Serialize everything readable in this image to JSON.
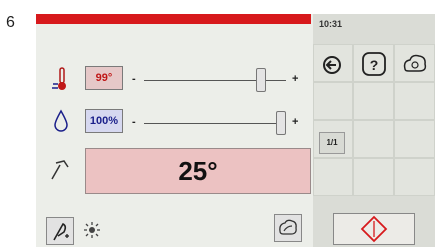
{
  "figure_number": "6",
  "status": {
    "time": "10:31"
  },
  "temperature": {
    "value": "99°",
    "minus": "-",
    "plus": "+",
    "level": 0.85
  },
  "humidity": {
    "value": "100%",
    "minus": "-",
    "plus": "+",
    "level": 1.0
  },
  "display": {
    "value": "25°"
  },
  "pager": {
    "label": "1/1"
  },
  "colors": {
    "accent_red": "#d7191c",
    "temp_value": "#c01818",
    "humidity_value": "#1a1f8a",
    "display_bg": "#ecc2c2"
  },
  "icons": [
    "thermometer-icon",
    "droplet-icon",
    "hammer-icon",
    "back-arrow-icon",
    "help-icon",
    "settings-cloud-icon",
    "feather-icon",
    "sparkle-icon",
    "leaf-cloud-icon",
    "red-diamond-icon"
  ]
}
